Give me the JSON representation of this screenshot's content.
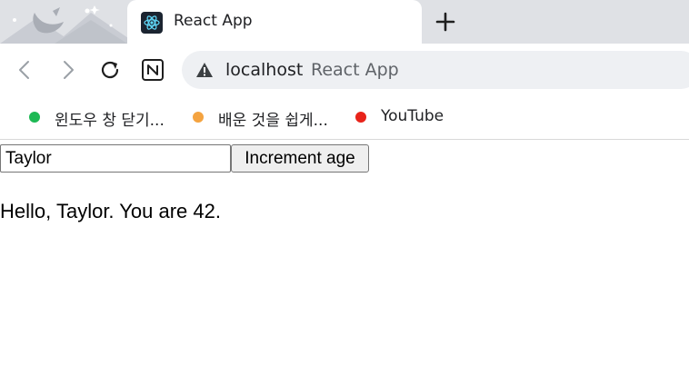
{
  "browser": {
    "tab": {
      "title": "React App",
      "favicon": "react-logo-icon"
    },
    "new_tab_icon": "plus-icon",
    "toolbar": {
      "back_icon": "back-arrow-icon",
      "forward_icon": "forward-arrow-icon",
      "reload_icon": "reload-icon",
      "extension_icon": "notion-icon",
      "omnibox": {
        "security_icon": "warning-triangle-icon",
        "host": "localhost",
        "page_title": "React App"
      }
    },
    "bookmarks": [
      {
        "label": "윈도우 창 닫기...",
        "color": "#1db954"
      },
      {
        "label": "배운 것을 쉽게...",
        "color": "#f4a340"
      },
      {
        "label": "YouTube",
        "color": "#e8231a"
      }
    ]
  },
  "app": {
    "name_input": {
      "value": "Taylor"
    },
    "increment_button": {
      "label": "Increment age"
    },
    "greeting": "Hello, Taylor. You are 42."
  }
}
